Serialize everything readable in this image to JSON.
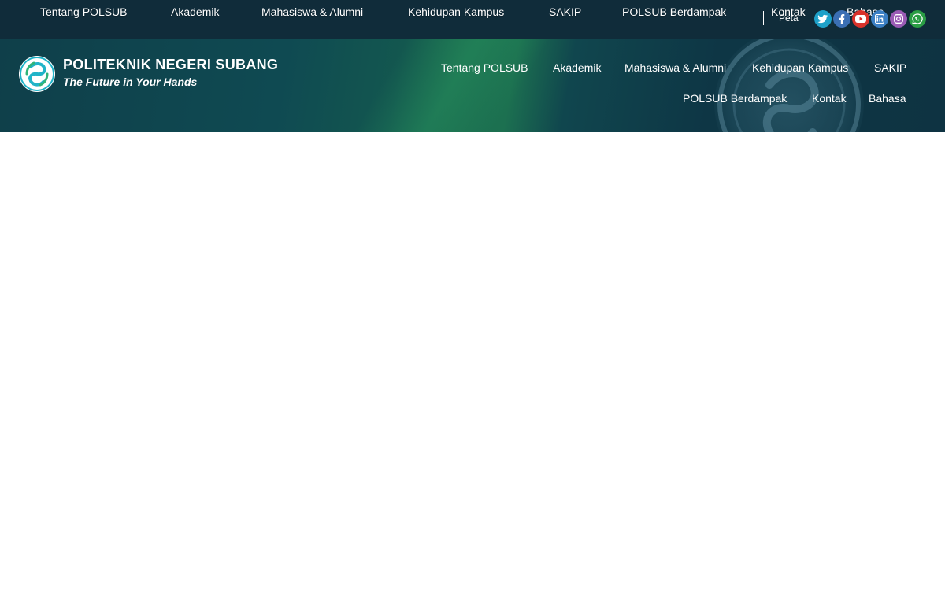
{
  "topbar": {
    "nav": [
      "Tentang POLSUB",
      "Akademik",
      "Mahasiswa & Alumni",
      "Kehidupan Kampus",
      "SAKIP",
      "POLSUB Berdampak",
      "Kontak",
      "Bahasa"
    ],
    "peta_label": "Peta",
    "social": [
      {
        "name": "twitter-icon",
        "color": "#1ea1c9"
      },
      {
        "name": "facebook-icon",
        "color": "#3b6fb4"
      },
      {
        "name": "youtube-icon",
        "color": "#d9322b"
      },
      {
        "name": "linkedin-icon",
        "color": "#3a7fc4"
      },
      {
        "name": "instagram-icon",
        "color": "#9b5bb5"
      },
      {
        "name": "whatsapp-icon",
        "color": "#2a9d44"
      }
    ]
  },
  "header": {
    "brand_title": "POLITEKNIK NEGERI SUBANG",
    "tagline": "The Future in Your Hands",
    "nav_row1": [
      "Tentang POLSUB",
      "Akademik",
      "Mahasiswa & Alumni",
      "Kehidupan Kampus",
      "SAKIP"
    ],
    "nav_row2": [
      "POLSUB Berdampak",
      "Kontak",
      "Bahasa"
    ]
  },
  "colors": {
    "topbar_bg": "#102c3a",
    "header_bg": "#0f3f4a",
    "logo_teal": "#20b3c8",
    "logo_green": "#2fb37a"
  }
}
